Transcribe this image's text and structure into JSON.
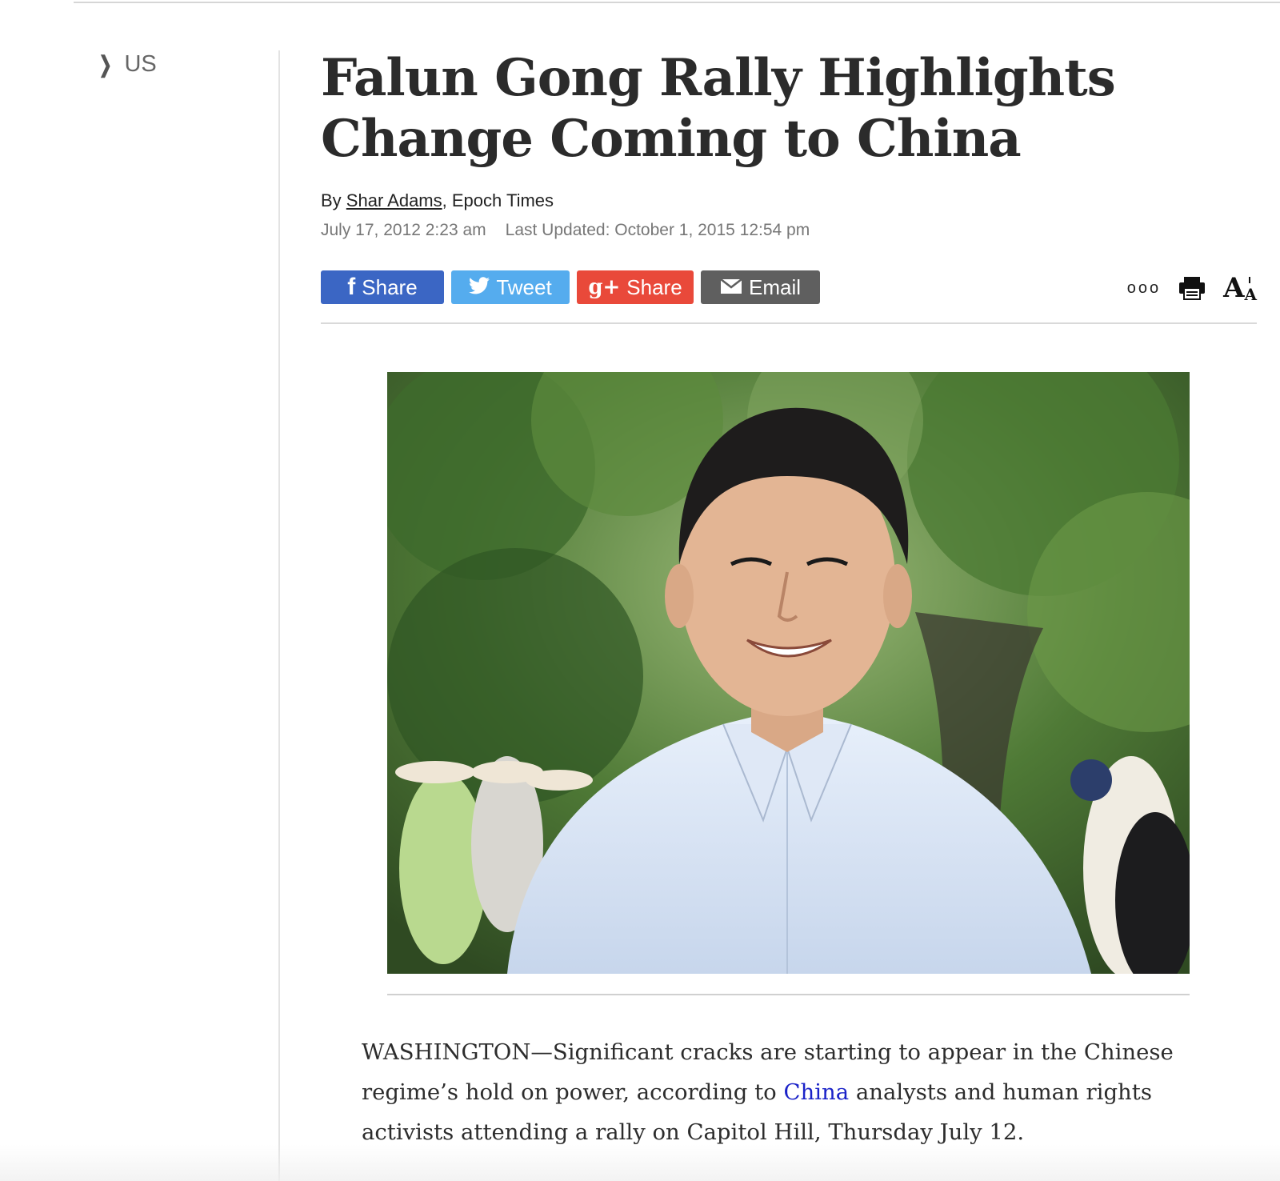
{
  "sidebar": {
    "breadcrumb_label": "US"
  },
  "article": {
    "headline": "Falun Gong Rally Highlights Change Coming to China",
    "byline": {
      "prefix": "By ",
      "author": "Shar Adams",
      "separator": ", ",
      "outlet": "Epoch Times"
    },
    "published": "July 17, 2012 2:23 am",
    "updated": "Last Updated: October 1, 2015 12:54 pm",
    "share_buttons": {
      "facebook": {
        "glyph": "f",
        "label": "Share",
        "color": "#3b66c4"
      },
      "twitter": {
        "label": "Tweet",
        "color": "#55acee"
      },
      "googleplus": {
        "glyph": "g+",
        "label": "Share",
        "color": "#e9493a"
      },
      "email": {
        "label": "Email",
        "color": "#5f5f5f"
      }
    },
    "tools": {
      "more": "ooo",
      "print": "print-icon",
      "text_size": {
        "big": "A",
        "small": "A"
      }
    },
    "body": {
      "part1": "WASHINGTON—Significant cracks are starting to appear in the Chinese regime’s hold on power, according to ",
      "link": "China",
      "part2": " analysts and human rights activists attending a rally on Capitol Hill, Thursday July 12."
    }
  }
}
